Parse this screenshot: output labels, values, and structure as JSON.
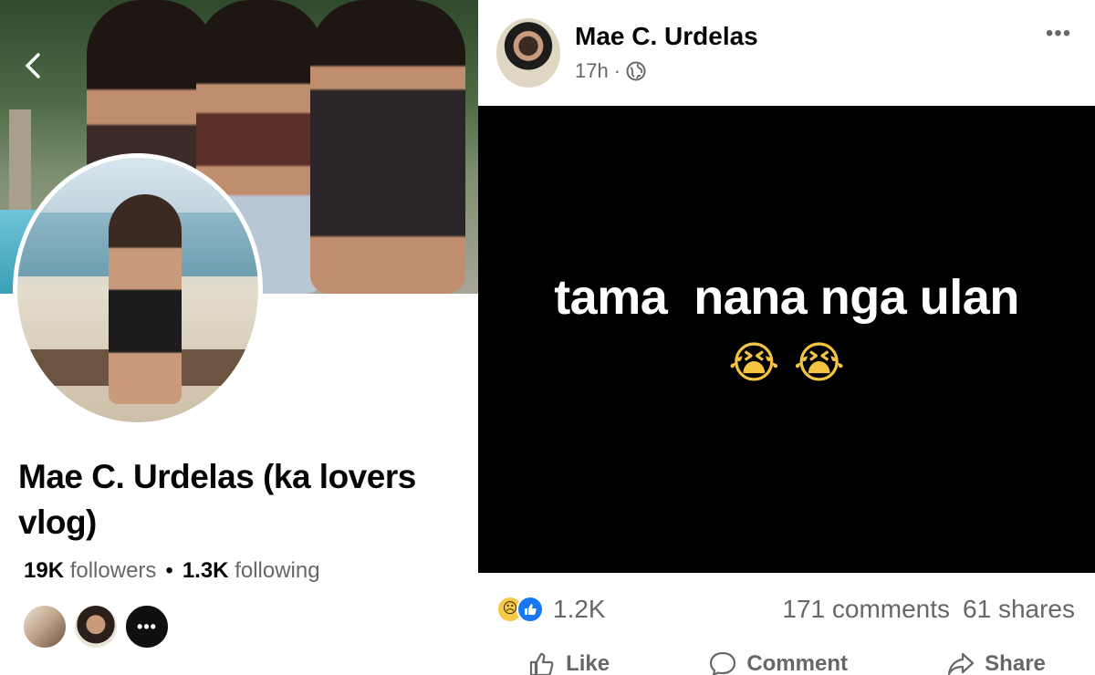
{
  "profile": {
    "back_icon": "chevron-left-icon",
    "name": "Mae C. Urdelas (ka lovers vlog)",
    "followers_count": "19K",
    "followers_label": "followers",
    "separator": "•",
    "following_count": "1.3K",
    "following_label": "following",
    "mutual_friends_more": "•••"
  },
  "post": {
    "author": "Mae C. Urdelas",
    "time": "17h",
    "meta_separator": "·",
    "privacy_icon": "globe-icon",
    "more_label": "•••",
    "text": "tama  nana nga ulan",
    "emoji": "😭 😭",
    "background_color": "#000000",
    "reactions": {
      "icons": [
        "sad-reaction-icon",
        "like-reaction-icon"
      ],
      "count": "1.2K"
    },
    "comments": "171 comments",
    "shares": "61 shares",
    "actions": {
      "like": "Like",
      "comment": "Comment",
      "share": "Share"
    }
  },
  "colors": {
    "brand_blue": "#1877f2",
    "text_primary": "#050505",
    "text_secondary": "#65676b"
  }
}
